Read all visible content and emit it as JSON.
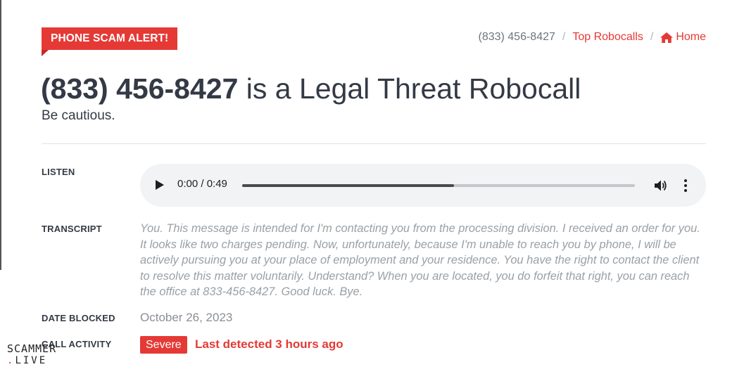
{
  "alert": {
    "label": "PHONE SCAM ALERT!"
  },
  "breadcrumb": {
    "current": "(833) 456-8427",
    "top_robocalls": "Top Robocalls",
    "home": "Home",
    "separator": "/"
  },
  "header": {
    "number": "(833) 456-8427",
    "title_rest": "is a Legal Threat Robocall",
    "subtitle": "Be cautious."
  },
  "details": {
    "listen_label": "LISTEN",
    "audio": {
      "time": "0:00 / 0:49",
      "progress_fraction": 0.54
    },
    "transcript_label": "TRANSCRIPT",
    "transcript": "You. This message is intended for I'm contacting you from the processing division. I received an order for you. It looks like two charges pending. Now, unfortunately, because I'm unable to reach you by phone, I will be actively pursuing you at your place of employment and your residence. You have the right to contact the client to resolve this matter voluntarily. Understand? When you are located, you do forfeit that right, you can reach the office at 833-456-8427. Good luck. Bye.",
    "date_blocked_label": "DATE BLOCKED",
    "date_blocked": "October 26, 2023",
    "call_activity_label": "CALL ACTIVITY",
    "severity": "Severe",
    "last_detected": "Last detected 3 hours ago"
  },
  "watermark": {
    "line1": "SCAMMER",
    "line2_dot": ".",
    "line2": "LIVE"
  },
  "colors": {
    "accent": "#e53935",
    "text": "#333a45",
    "muted": "#9aa0a6"
  },
  "icons": [
    "home-icon",
    "play-icon",
    "volume-icon",
    "more-vert-icon"
  ]
}
